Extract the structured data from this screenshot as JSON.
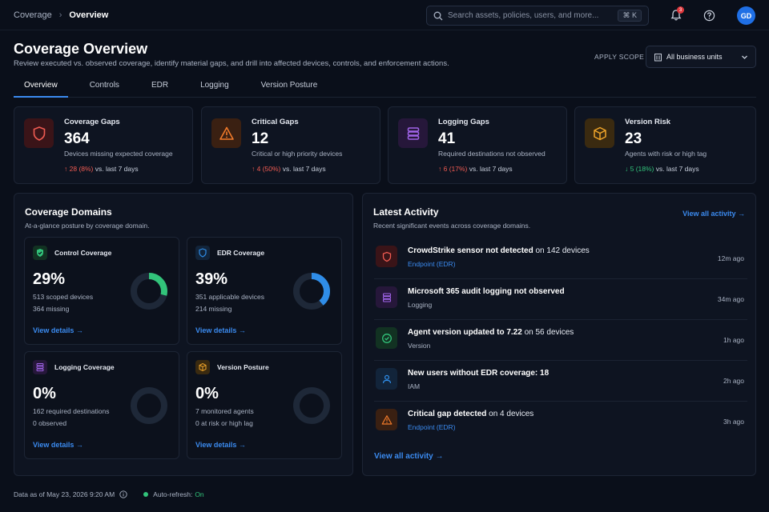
{
  "breadcrumb": [
    "Coverage",
    "Overview"
  ],
  "search": {
    "placeholder": "Search assets, policies, users, and more...",
    "shortcut": "⌘ K"
  },
  "notifications": {
    "count": "3"
  },
  "user": {
    "initials": "GD"
  },
  "page": {
    "title": "Coverage Overview",
    "subtitle": "Review executed vs. observed coverage, identify material gaps, and drill into affected devices, controls, and enforcement actions."
  },
  "scope": {
    "label": "APPLY SCOPE",
    "value": "All business units"
  },
  "tabs": [
    "Overview",
    "Controls",
    "EDR",
    "Logging",
    "Version Posture"
  ],
  "stats": [
    {
      "title": "Coverage Gaps",
      "value": "364",
      "desc": "Devices missing expected coverage",
      "delta": "28 (8%)",
      "delta_suffix": "vs. last 7 days",
      "direction": "up",
      "icon": "shield-icon",
      "color": "#e0393e"
    },
    {
      "title": "Critical Gaps",
      "value": "12",
      "desc": "Critical or high priority devices",
      "delta": "4 (50%)",
      "delta_suffix": "vs. last 7 days",
      "direction": "up",
      "icon": "warning-icon",
      "color": "#f07a2a"
    },
    {
      "title": "Logging Gaps",
      "value": "41",
      "desc": "Required destinations not observed",
      "delta": "6 (17%)",
      "delta_suffix": "vs. last 7 days",
      "direction": "up",
      "icon": "database-icon",
      "color": "#a064e8"
    },
    {
      "title": "Version Risk",
      "value": "23",
      "desc": "Agents with risk or high tag",
      "delta": "5 (18%)",
      "delta_suffix": "vs. last 7 days",
      "direction": "down",
      "icon": "cube-icon",
      "color": "#f0a52a"
    }
  ],
  "domains": {
    "title": "Coverage Domains",
    "subtitle": "At-a-glance posture by coverage domain.",
    "cards": [
      {
        "title": "Control Coverage",
        "value": "29%",
        "line1": "513 scoped devices",
        "line2": "364 missing",
        "link": "View details →",
        "percent": 29,
        "color": "#32c37a",
        "icon": "shield-check-icon"
      },
      {
        "title": "EDR Coverage",
        "value": "39%",
        "line1": "351 applicable devices",
        "line2": "214 missing",
        "link": "View details →",
        "percent": 39,
        "color": "#2f8de8",
        "icon": "shield-icon"
      },
      {
        "title": "Logging Coverage",
        "value": "0%",
        "line1": "162 required destinations",
        "line2": "0 observed",
        "link": "View details →",
        "percent": 0,
        "color": "#a064e8",
        "icon": "database-icon"
      },
      {
        "title": "Version Posture",
        "value": "0%",
        "line1": "7 monitored agents",
        "line2": "0 at risk or high lag",
        "link": "View details →",
        "percent": 0,
        "color": "#f0a52a",
        "icon": "cube-icon"
      }
    ]
  },
  "activity": {
    "title": "Latest Activity",
    "subtitle": "Recent significant events across coverage domains.",
    "view_all": "View all activity →",
    "items": [
      {
        "title_bold": "CrowdStrike sensor not detected",
        "title_rest": " on 142 devices",
        "sub": "Endpoint (EDR)",
        "sub_link": true,
        "time": "12m ago",
        "icon": "shield-icon",
        "color": "#e0393e"
      },
      {
        "title_bold": "Microsoft 365 audit logging not observed",
        "title_rest": "",
        "sub": "Logging",
        "sub_link": false,
        "time": "34m ago",
        "icon": "database-icon",
        "color": "#a064e8"
      },
      {
        "title_bold": "Agent version updated to 7.22",
        "title_rest": " on 56 devices",
        "sub": "Version",
        "sub_link": false,
        "time": "1h ago",
        "icon": "check-circle-icon",
        "color": "#32c37a"
      },
      {
        "title_bold": "New users without EDR coverage: 18",
        "title_rest": "",
        "sub": "IAM",
        "sub_link": false,
        "time": "2h ago",
        "icon": "user-icon",
        "color": "#2f8de8"
      },
      {
        "title_bold": "Critical gap detected",
        "title_rest": " on 4 devices",
        "sub": "Endpoint (EDR)",
        "sub_link": true,
        "time": "3h ago",
        "icon": "warning-icon",
        "color": "#f07a2a"
      }
    ]
  },
  "footer": {
    "data_as_of": "Data as of May 23, 2026 9:20 AM",
    "autorefresh_label": "Auto-refresh:",
    "autorefresh_value": "On"
  }
}
